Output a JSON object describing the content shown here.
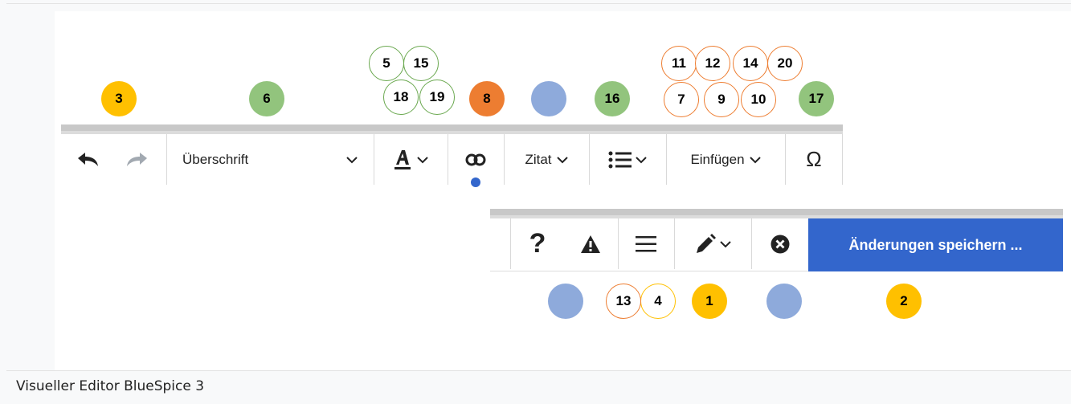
{
  "toolbar": {
    "heading_label": "Überschrift",
    "cite_label": "Zitat",
    "insert_label": "Einfügen",
    "special_char_label": "Ω"
  },
  "actions": {
    "help_label": "?",
    "save_label": "Änderungen speichern ..."
  },
  "markers": {
    "m1": "1",
    "m2": "2",
    "m3": "3",
    "m4": "4",
    "m5": "5",
    "m6": "6",
    "m7": "7",
    "m8": "8",
    "m9": "9",
    "m10": "10",
    "m11": "11",
    "m12": "12",
    "m13": "13",
    "m14": "14",
    "m15": "15",
    "m16": "16",
    "m17": "17",
    "m18": "18",
    "m19": "19",
    "m20": "20"
  },
  "caption": "Visueller Editor BlueSpice 3",
  "colors": {
    "accent_blue": "#3366cc",
    "marker_yellow": "#ffc000",
    "marker_green": "#92c47d",
    "marker_orange": "#ed7d31",
    "marker_blue": "#8eaadb"
  }
}
